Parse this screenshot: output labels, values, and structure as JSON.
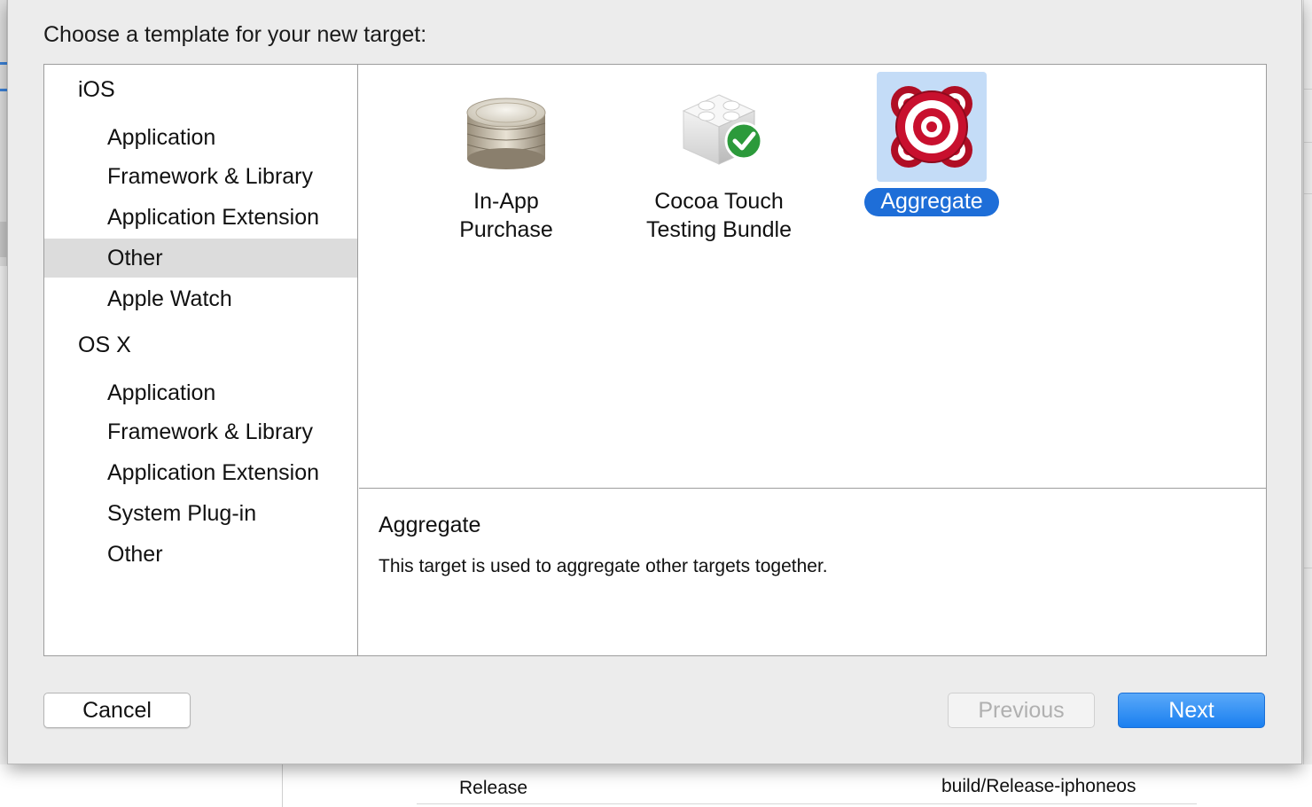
{
  "dialog": {
    "prompt": "Choose a template for your new target:"
  },
  "sidebar": {
    "platforms": [
      {
        "name": "iOS",
        "categories": [
          "Application",
          "Framework & Library",
          "Application Extension",
          "Other",
          "Apple Watch"
        ]
      },
      {
        "name": "OS X",
        "categories": [
          "Application",
          "Framework & Library",
          "Application Extension",
          "System Plug-in",
          "Other"
        ]
      }
    ],
    "selected": "iOS / Other"
  },
  "templates": [
    {
      "name_line1": "In-App",
      "name_line2": "Purchase",
      "icon": "coins-stack-icon"
    },
    {
      "name_line1": "Cocoa Touch",
      "name_line2": "Testing Bundle",
      "icon": "lego-brick-checkmark-icon"
    },
    {
      "name_line1": "Aggregate",
      "name_line2": "",
      "icon": "target-bullseye-icon",
      "selected": true
    }
  ],
  "detail": {
    "title": "Aggregate",
    "description": "This target is used to aggregate other targets together."
  },
  "buttons": {
    "cancel": "Cancel",
    "previous": "Previous",
    "next": "Next"
  },
  "background": {
    "config_name": "Release",
    "build_path": "build/Release-iphoneos"
  },
  "colors": {
    "accent": "#1e6ed8",
    "selection_row": "#dcdcdc",
    "icon_selection": "#c4dcf7",
    "target_red": "#c8102e"
  }
}
